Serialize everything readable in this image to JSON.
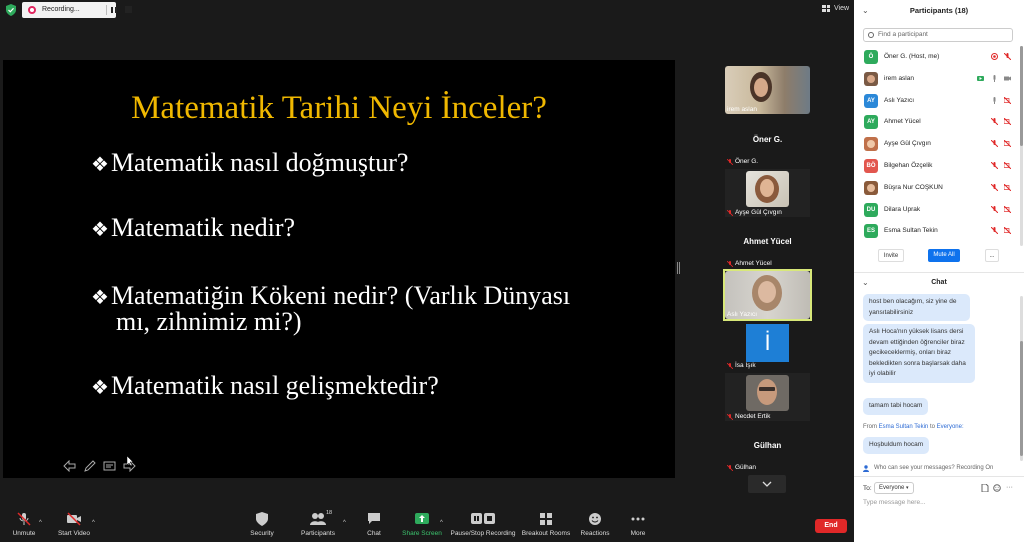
{
  "colors": {
    "slide_title": "#f0b800",
    "accent_blue": "#0e72ed",
    "end_red": "#e02828",
    "active_speaker": "#d8e87a",
    "recording_red": "#e0245e"
  },
  "topbar": {
    "recording_label": "Recording...",
    "view_label": "View",
    "view_icon": "grid-icon"
  },
  "slide": {
    "title": "Matematik Tarihi Neyi İnceler?",
    "bullet_marker": "❖",
    "bullets": [
      "Matematik nasıl doğmuştur?",
      "Matematik nedir?",
      "Matematiğin Kökeni nedir? (Varlık Dünyası",
      "Matematik nasıl gelişmektedir?"
    ],
    "bullet3_continuation": "mı, zihnimiz mi?)"
  },
  "gallery": [
    {
      "name": "irem aslan",
      "type": "photo",
      "muted": false
    },
    {
      "name": "Öner G.",
      "type": "name",
      "muted": true
    },
    {
      "name": "Ayşe Gül Çıvgın",
      "type": "photo",
      "muted": true
    },
    {
      "name": "Ahmet Yücel",
      "type": "name",
      "muted": true
    },
    {
      "name": "Aslı Yazıcı",
      "type": "photo",
      "muted": false,
      "active": true
    },
    {
      "name": "İsa Işık",
      "type": "avatar",
      "initial": "İ",
      "muted": true
    },
    {
      "name": "Necdet Ertik",
      "type": "photo",
      "muted": true
    },
    {
      "name": "Gülhan",
      "type": "name",
      "muted": true
    }
  ],
  "toolbar": {
    "unmute": "Unmute",
    "start_video": "Start Video",
    "security": "Security",
    "participants": "Participants",
    "participants_count": "18",
    "chat": "Chat",
    "share_screen": "Share Screen",
    "pause_stop_recording": "Pause/Stop Recording",
    "breakout_rooms": "Breakout Rooms",
    "reactions": "Reactions",
    "more": "More",
    "end": "End"
  },
  "participants_panel": {
    "title": "Participants (18)",
    "search_placeholder": "Find a participant",
    "invite": "Invite",
    "mute_all": "Mute All",
    "more": "...",
    "list": [
      {
        "initials": "Ö",
        "name": "Öner G. (Host, me)",
        "color": "#2eaa5c",
        "mic": "muted",
        "video": "off",
        "recording": true
      },
      {
        "initials": "",
        "name": "irem aslan",
        "color": "#7a5a45",
        "photo": true,
        "mic": "on",
        "video": "on"
      },
      {
        "initials": "AY",
        "name": "Aslı Yazıcı",
        "color": "#2b88d8",
        "mic": "on",
        "video": "off"
      },
      {
        "initials": "AY",
        "name": "Ahmet Yücel",
        "color": "#2eaa5c",
        "mic": "muted",
        "video": "off"
      },
      {
        "initials": "",
        "name": "Ayşe Gül Çıvgın",
        "color": "#c0704a",
        "photo": true,
        "mic": "muted",
        "video": "off"
      },
      {
        "initials": "BÖ",
        "name": "Bilgehan Özçelik",
        "color": "#e2564e",
        "mic": "muted",
        "video": "off"
      },
      {
        "initials": "",
        "name": "Büşra Nur COŞKUN",
        "color": "#8a5a3a",
        "photo": true,
        "mic": "muted",
        "video": "off"
      },
      {
        "initials": "DU",
        "name": "Dilara Uprak",
        "color": "#2eaa5c",
        "mic": "muted",
        "video": "off"
      },
      {
        "initials": "ES",
        "name": "Esma Sultan Tekin",
        "color": "#2eaa5c",
        "mic": "muted",
        "video": "off"
      }
    ]
  },
  "chat_panel": {
    "title": "Chat",
    "messages": [
      "host ben olacağım, siz yine de yansıtabilirsiniz",
      "Aslı Hoca'nın yüksek lisans dersi devam ettiğinden öğrenciler biraz gecikeceklermiş, onları biraz bekledikten sonra başlarsak daha iyi olabilir",
      "tamam tabi hocam",
      "Hoşbuldum hocam"
    ],
    "from_prefix": "From",
    "from_sender": "Esma Sultan Tekin",
    "from_to": "to",
    "from_target": "Everyone:",
    "who_can_see": "Who can see your messages? Recording On",
    "to_label": "To:",
    "to_value": "Everyone",
    "input_placeholder": "Type message here..."
  }
}
